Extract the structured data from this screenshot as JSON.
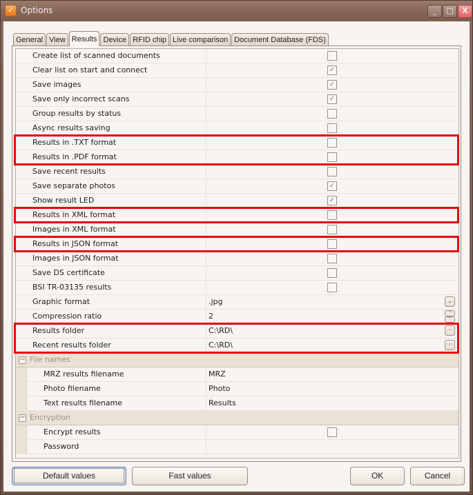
{
  "window": {
    "title": "Options",
    "controls": {
      "minimize": "_",
      "maximize": "□",
      "close": "X"
    }
  },
  "tabs": [
    {
      "label": "General",
      "active": false
    },
    {
      "label": "View",
      "active": false
    },
    {
      "label": "Results",
      "active": true
    },
    {
      "label": "Device",
      "active": false
    },
    {
      "label": "RFID chip",
      "active": false
    },
    {
      "label": "Live comparison",
      "active": false
    },
    {
      "label": "Document Database (FDS)",
      "active": false
    }
  ],
  "properties": [
    {
      "label": "Create list of scanned documents",
      "type": "checkbox",
      "checked": false
    },
    {
      "label": "Clear list on start and connect",
      "type": "checkbox",
      "checked": true
    },
    {
      "label": "Save images",
      "type": "checkbox",
      "checked": true
    },
    {
      "label": "Save only incorrect scans",
      "type": "checkbox",
      "checked": true
    },
    {
      "label": "Group results by status",
      "type": "checkbox",
      "checked": false
    },
    {
      "label": "Async results saving",
      "type": "checkbox",
      "checked": false
    },
    {
      "label": "Results in .TXT format",
      "type": "checkbox",
      "checked": false
    },
    {
      "label": "Results in .PDF format",
      "type": "checkbox",
      "checked": false
    },
    {
      "label": "Save recent results",
      "type": "checkbox",
      "checked": false
    },
    {
      "label": "Save separate photos",
      "type": "checkbox",
      "checked": true
    },
    {
      "label": "Show result LED",
      "type": "checkbox",
      "checked": true
    },
    {
      "label": "Results in XML format",
      "type": "checkbox",
      "checked": false
    },
    {
      "label": "Images in XML format",
      "type": "checkbox",
      "checked": false
    },
    {
      "label": "Results in JSON format",
      "type": "checkbox",
      "checked": false
    },
    {
      "label": "Images in JSON format",
      "type": "checkbox",
      "checked": false
    },
    {
      "label": "Save DS certificate",
      "type": "checkbox",
      "checked": false
    },
    {
      "label": "BSI TR-03135 results",
      "type": "checkbox",
      "checked": false
    },
    {
      "label": "Graphic format",
      "type": "dropdown",
      "value": ".jpg"
    },
    {
      "label": "Compression ratio",
      "type": "spinner",
      "value": "2"
    },
    {
      "label": "Results folder",
      "type": "folder",
      "value": "C:\\RD\\"
    },
    {
      "label": "Recent results folder",
      "type": "folder",
      "value": "C:\\RD\\"
    }
  ],
  "categories": [
    {
      "label": "File names",
      "expanded": true,
      "items": [
        {
          "label": "MRZ results filename",
          "type": "text",
          "value": "MRZ"
        },
        {
          "label": "Photo filename",
          "type": "text",
          "value": "Photo"
        },
        {
          "label": "Text results filename",
          "type": "text",
          "value": "Results"
        }
      ]
    },
    {
      "label": "Encryption",
      "expanded": true,
      "items": [
        {
          "label": "Encrypt results",
          "type": "checkbox",
          "checked": false
        },
        {
          "label": "Password",
          "type": "text",
          "value": ""
        }
      ]
    }
  ],
  "glyphs": {
    "check": "✓",
    "dropdown": "⌄",
    "spin_up": "˄",
    "spin_down": "˅",
    "ellipsis": "···",
    "collapse": "−"
  },
  "highlight_color": "#e8000a",
  "buttons": {
    "default_values": "Default values",
    "fast_values": "Fast values",
    "ok": "OK",
    "cancel": "Cancel"
  }
}
